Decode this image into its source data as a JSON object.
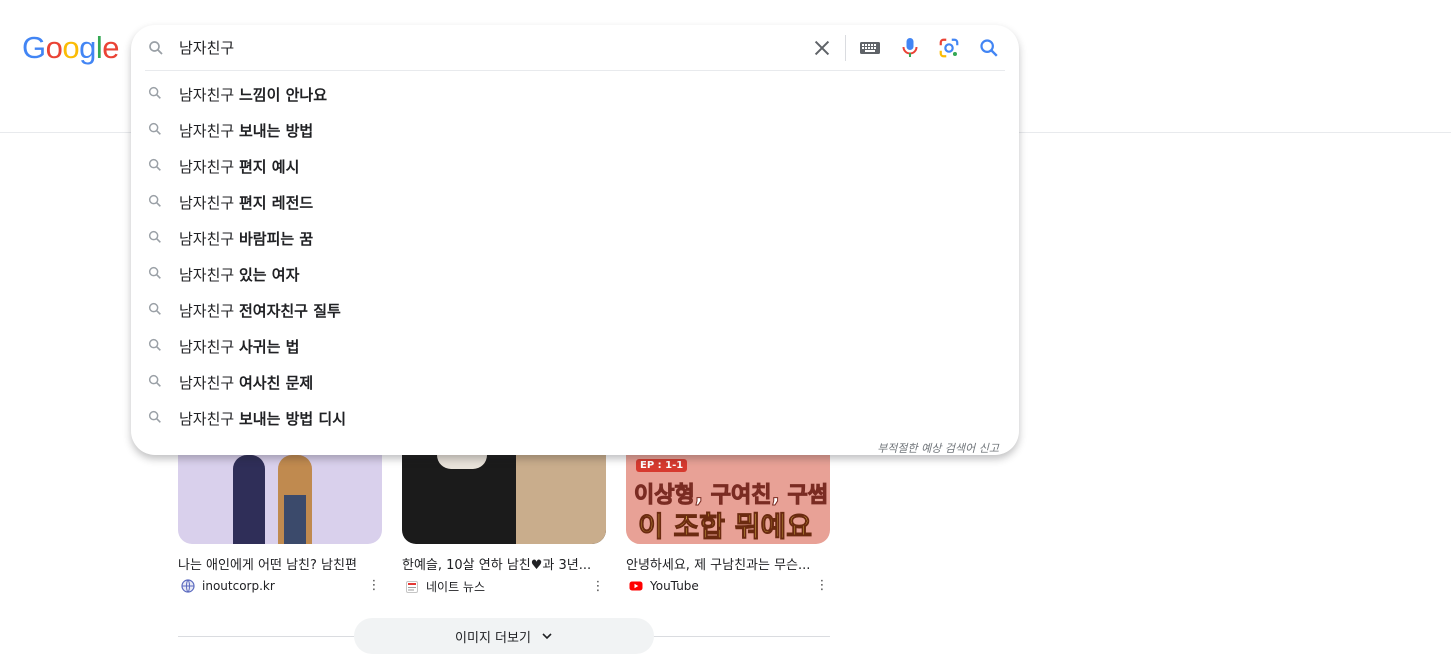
{
  "logo": {
    "text": "Google",
    "letters": [
      "G",
      "o",
      "o",
      "g",
      "l",
      "e"
    ]
  },
  "search": {
    "query": "남자친구",
    "suggestion_prefix": "남자친구",
    "suggestions": [
      "느낌이 안나요",
      "보내는 방법",
      "편지 예시",
      "편지 레전드",
      "바람피는 꿈",
      "있는 여자",
      "전여자친구 질투",
      "사귀는 법",
      "여사친 문제",
      "보내는 방법 디시"
    ],
    "report_link": "부적절한 예상 검색어 신고"
  },
  "images": [
    {
      "caption": "나는 애인에게 어떤 남친? 남친편",
      "source": "inoutcorp.kr",
      "thumb_text": []
    },
    {
      "caption": "한예슬, 10살 연하 남친♥과 3년...",
      "source": "네이트 뉴스",
      "thumb_text": []
    },
    {
      "caption": "안녕하세요, 제 구남친과는 무슨...",
      "source": "YouTube",
      "thumb_text": [
        "EP : 1-1",
        "이상형, 구여친, 구썸",
        "이 조합 뭐예요"
      ]
    }
  ],
  "more_images": {
    "label": "이미지 더보기"
  },
  "colors": {
    "blue": "#4285f4",
    "red": "#ea4335",
    "yellow": "#fbbc05",
    "green": "#34a853"
  }
}
